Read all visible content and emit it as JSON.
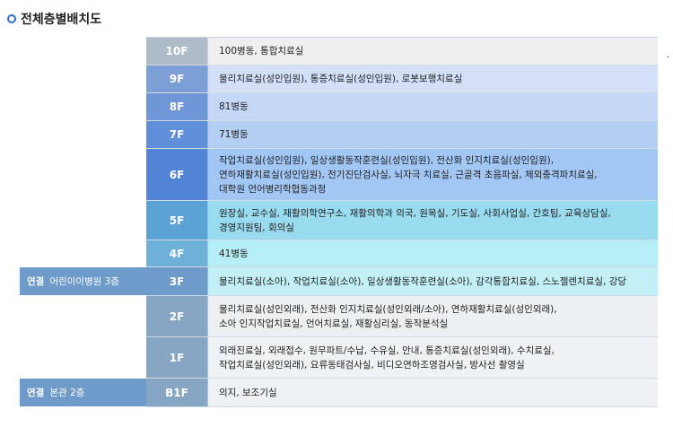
{
  "page": {
    "title": "전체층별배치도"
  },
  "side_dot": "·",
  "links": [
    {
      "tag": "연결",
      "name": "어린이이병원 3층"
    },
    {
      "tag": "연결",
      "name": "본관 2층"
    }
  ],
  "rows": [
    {
      "floor": "10F",
      "floor_color": "#aebbc8",
      "desc_color": "#efefef",
      "lines": [
        "100병동, 통합치료실"
      ]
    },
    {
      "floor": "9F",
      "floor_color": "#7c9fd6",
      "desc_color": "#d3e0f8",
      "lines": [
        "물리치료실(성인입원), 통증치료실(성인입원), 로봇보행치료실"
      ]
    },
    {
      "floor": "8F",
      "floor_color": "#6f96d7",
      "desc_color": "#c4d7f7",
      "lines": [
        "81병동"
      ]
    },
    {
      "floor": "7F",
      "floor_color": "#5f8fd8",
      "desc_color": "#b4cff3",
      "lines": [
        "71병동"
      ]
    },
    {
      "floor": "6F",
      "floor_color": "#5284d6",
      "desc_color": "#a2c7f5",
      "lines": [
        "작업치료실(성인입원), 일상생활동작훈련실(성인입원), 전산화 인지치료실(성인입원),",
        "연하재활치료실(성인입원), 전기진단검사실, 뇌자극 치료실, 근골격 초음파실, 체외충격파치료실,",
        "대학원 언어병리학협동과정"
      ]
    },
    {
      "floor": "5F",
      "floor_color": "#5aa3d4",
      "desc_color": "#99dcef",
      "lines": [
        "원장실, 교수실, 재활의학연구소, 재활의학과 의국, 원목실, 기도실, 사회사업실, 간호팀, 교육상담실,",
        "경영지원팀, 회의실"
      ]
    },
    {
      "floor": "4F",
      "floor_color": "#6fb0d8",
      "desc_color": "#b6eef7",
      "lines": [
        "41병동"
      ]
    },
    {
      "floor": "3F",
      "floor_color": "#6e9bc9",
      "desc_color": "#c3f0f7",
      "lines": [
        "물리치료실(소아), 작업치료실(소아), 일상생활동작훈련실(소아), 감각통합치료실, 스노젤렌치료실, 강당"
      ]
    },
    {
      "floor": "2F",
      "floor_color": "#86a6c4",
      "desc_color": "#ecf0f3",
      "lines": [
        "물리치료실(성인외래),  전산화 인지치료실(성인외래/소아), 연하재활치료실(성인외래),",
        "소아 인지작업치료실, 언어치료실, 재활심리실, 동작분석실"
      ]
    },
    {
      "floor": "1F",
      "floor_color": "#86a6c4",
      "desc_color": "#eef2f5",
      "lines": [
        "외래진료실, 외래접수, 원무파트/수납, 수유실, 안내, 통증치료실(성인외래), 수치료실,",
        "작업치료실(성인외래), 요류동태검사실, 비디오연하조영검사실, 방사선 촬영실"
      ]
    },
    {
      "floor": "B1F",
      "floor_color": "#86a6c4",
      "desc_color": "#eef1f4",
      "lines": [
        "의지, 보조기실"
      ]
    }
  ]
}
